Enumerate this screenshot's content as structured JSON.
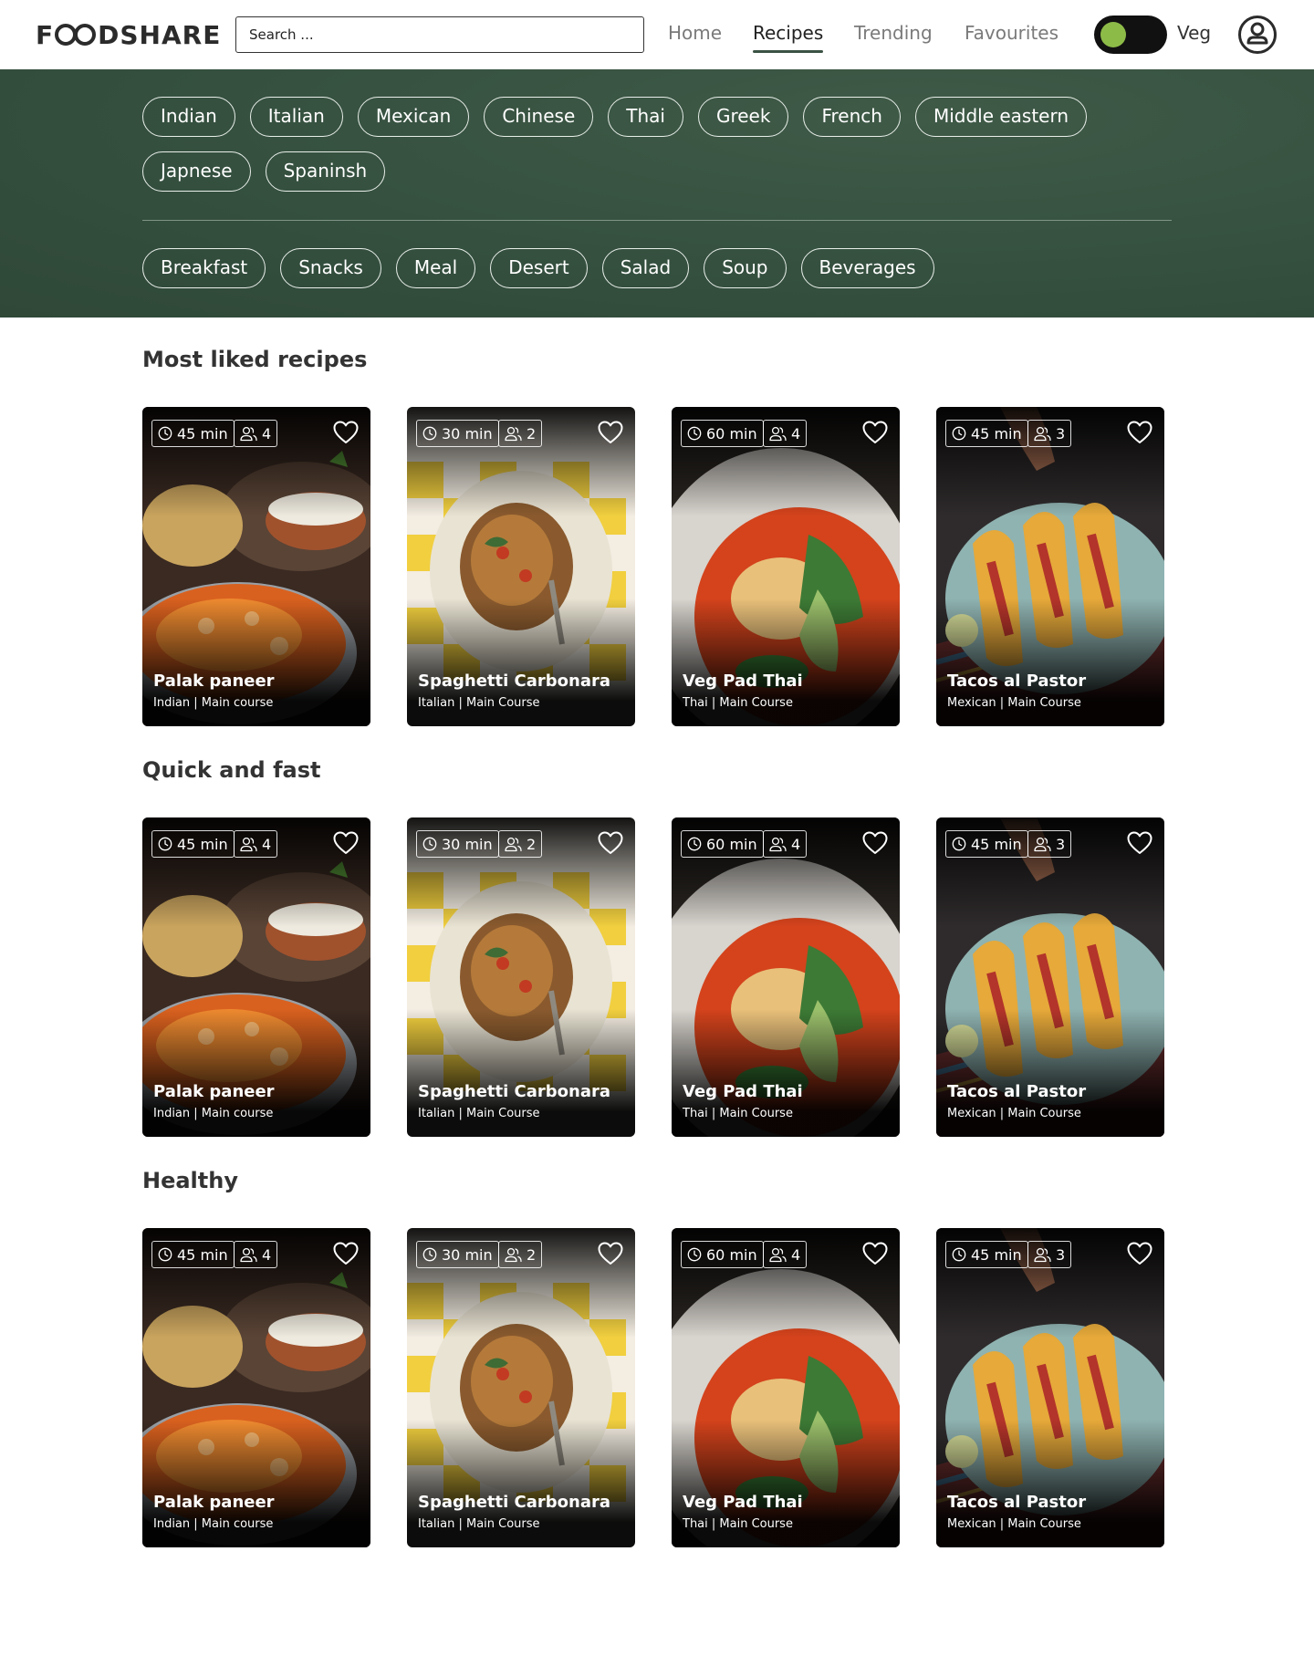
{
  "brand": {
    "name_start": "F",
    "name_end": "DSHARE"
  },
  "search": {
    "placeholder": "Search ..."
  },
  "nav": [
    {
      "label": "Home",
      "active": false
    },
    {
      "label": "Recipes",
      "active": true
    },
    {
      "label": "Trending",
      "active": false
    },
    {
      "label": "Favourites",
      "active": false
    }
  ],
  "veg_toggle": {
    "label": "Veg",
    "on": true,
    "accent": "#8dbb48"
  },
  "colors": {
    "band": "#35503f",
    "accent": "#8dbb48"
  },
  "cuisines": [
    "Indian",
    "Italian",
    "Mexican",
    "Chinese",
    "Thai",
    "Greek",
    "French",
    "Middle eastern",
    "Japnese",
    "Spaninsh"
  ],
  "meal_types": [
    "Breakfast",
    "Snacks",
    "Meal",
    "Desert",
    "Salad",
    "Soup",
    "Beverages"
  ],
  "sections": [
    {
      "title": "Most liked recipes",
      "cards": [
        {
          "time": "45 min",
          "servings": "4",
          "title": "Palak paneer",
          "meta": "Indian | Main course",
          "image": "curry"
        },
        {
          "time": "30 min",
          "servings": "2",
          "title": "Spaghetti Carbonara",
          "meta": "Italian | Main Course",
          "image": "pasta"
        },
        {
          "time": "60 min",
          "servings": "4",
          "title": "Veg Pad Thai",
          "meta": "Thai | Main Course",
          "image": "noodles"
        },
        {
          "time": "45 min",
          "servings": "3",
          "title": "Tacos al Pastor",
          "meta": "Mexican | Main Course",
          "image": "tacos"
        }
      ]
    },
    {
      "title": "Quick and fast",
      "cards": [
        {
          "time": "45 min",
          "servings": "4",
          "title": "Palak paneer",
          "meta": "Indian | Main course",
          "image": "curry"
        },
        {
          "time": "30 min",
          "servings": "2",
          "title": "Spaghetti Carbonara",
          "meta": "Italian | Main Course",
          "image": "pasta"
        },
        {
          "time": "60 min",
          "servings": "4",
          "title": "Veg Pad Thai",
          "meta": "Thai | Main Course",
          "image": "noodles"
        },
        {
          "time": "45 min",
          "servings": "3",
          "title": "Tacos al Pastor",
          "meta": "Mexican | Main Course",
          "image": "tacos"
        }
      ]
    },
    {
      "title": "Healthy",
      "cards": [
        {
          "time": "45 min",
          "servings": "4",
          "title": "Palak paneer",
          "meta": "Indian | Main course",
          "image": "curry"
        },
        {
          "time": "30 min",
          "servings": "2",
          "title": "Spaghetti Carbonara",
          "meta": "Italian | Main Course",
          "image": "pasta"
        },
        {
          "time": "60 min",
          "servings": "4",
          "title": "Veg Pad Thai",
          "meta": "Thai | Main Course",
          "image": "noodles"
        },
        {
          "time": "45 min",
          "servings": "3",
          "title": "Tacos al Pastor",
          "meta": "Mexican | Main Course",
          "image": "tacos"
        }
      ]
    }
  ]
}
